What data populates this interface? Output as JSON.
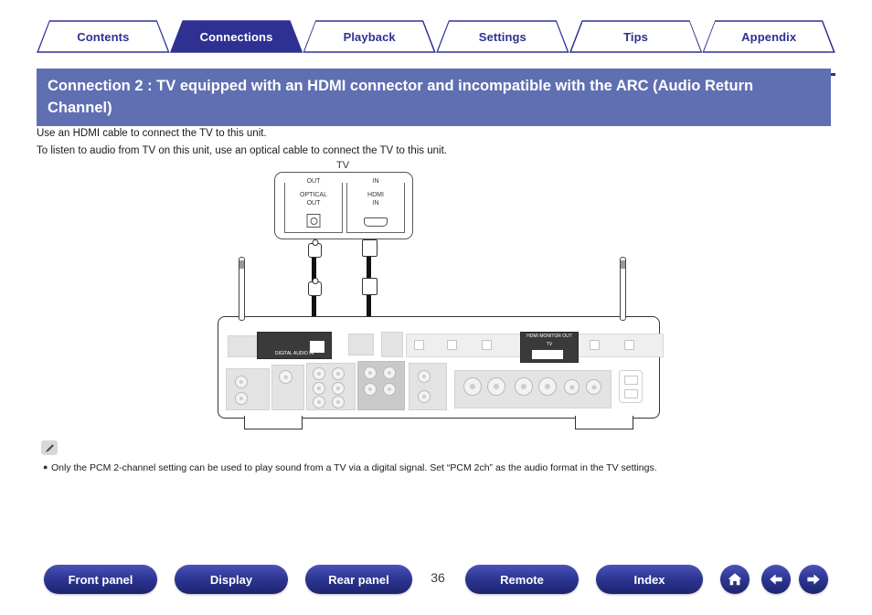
{
  "tabs": [
    {
      "label": "Contents",
      "active": false
    },
    {
      "label": "Connections",
      "active": true
    },
    {
      "label": "Playback",
      "active": false
    },
    {
      "label": "Settings",
      "active": false
    },
    {
      "label": "Tips",
      "active": false
    },
    {
      "label": "Appendix",
      "active": false
    }
  ],
  "title": "Connection 2 : TV equipped with an HDMI connector and incompatible with the ARC (Audio Return Channel)",
  "body": {
    "line1": "Use an HDMI cable to connect the TV to this unit.",
    "line2": "To listen to audio from TV on this unit, use an optical cable to connect the TV to this unit."
  },
  "diagram": {
    "tv_label": "TV",
    "optical_port": {
      "caption": "OUT",
      "line1": "OPTICAL",
      "line2": "OUT"
    },
    "hdmi_port": {
      "caption": "IN",
      "line1": "HDMI",
      "line2": "IN"
    },
    "receiver_digital_in_label": "DIGITAL AUDIO IN",
    "receiver_hdmi_out_label": "HDMI MONITOR OUT",
    "receiver_hdmi_out_tv": "TV"
  },
  "note": {
    "icon": "pencil-icon",
    "bullet": "●",
    "text": "Only the PCM 2-channel setting can be used to play sound from a TV via a digital signal. Set “PCM 2ch” as the audio format in the TV settings."
  },
  "bottom": {
    "buttons": [
      {
        "label": "Front panel"
      },
      {
        "label": "Display"
      },
      {
        "label": "Rear panel"
      },
      {
        "label": "Remote"
      },
      {
        "label": "Index"
      }
    ],
    "page_number": "36",
    "icons": [
      {
        "name": "home-icon"
      },
      {
        "name": "arrow-left-icon"
      },
      {
        "name": "arrow-right-icon"
      }
    ]
  },
  "colors": {
    "accent": "#2e3192",
    "title_banner": "#5f6fb2",
    "tab_text": "#2e3192"
  }
}
